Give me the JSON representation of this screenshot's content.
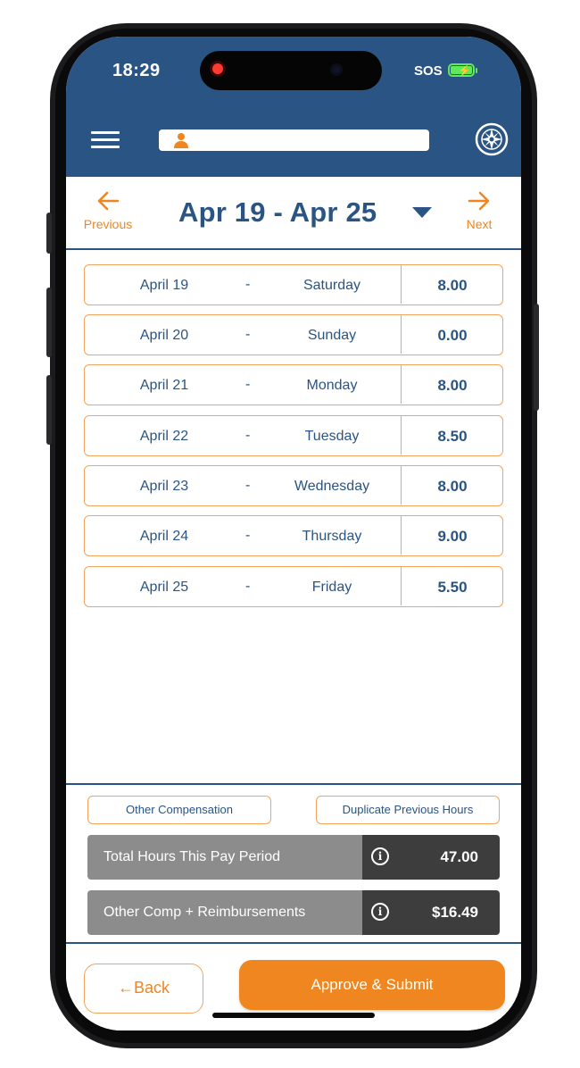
{
  "status_bar": {
    "time": "18:29",
    "carrier": "SOS",
    "battery_icon": "battery-charging-icon"
  },
  "header": {
    "menu_icon": "hamburger-menu-icon",
    "user_icon": "person-icon",
    "user_name": "",
    "settings_icon": "compass-icon",
    "color": "#2a5483"
  },
  "nav": {
    "previous_label": "Previous",
    "next_label": "Next",
    "period": "Apr 19 - Apr 25",
    "dropdown_icon": "caret-down-icon"
  },
  "days": [
    {
      "date": "April 19",
      "separator": "-",
      "weekday": "Saturday",
      "hours": "8.00"
    },
    {
      "date": "April 20",
      "separator": "-",
      "weekday": "Sunday",
      "hours": "0.00"
    },
    {
      "date": "April 21",
      "separator": "-",
      "weekday": "Monday",
      "hours": "8.00"
    },
    {
      "date": "April 22",
      "separator": "-",
      "weekday": "Tuesday",
      "hours": "8.50"
    },
    {
      "date": "April 23",
      "separator": "-",
      "weekday": "Wednesday",
      "hours": "8.00"
    },
    {
      "date": "April 24",
      "separator": "-",
      "weekday": "Thursday",
      "hours": "9.00"
    },
    {
      "date": "April 25",
      "separator": "-",
      "weekday": "Friday",
      "hours": "5.50"
    }
  ],
  "footer": {
    "other_compensation_label": "Other Compensation",
    "duplicate_label": "Duplicate Previous Hours",
    "total_hours_label": "Total Hours This Pay Period",
    "total_hours_value": "47.00",
    "other_comp_label": "Other Comp + Reimbursements",
    "other_comp_value": "$16.49",
    "info_icon": "info-icon"
  },
  "actions": {
    "back_label": "Back",
    "back_arrow": "←",
    "submit_label": "Approve & Submit"
  },
  "colors": {
    "accent": "#f0861f",
    "primary": "#2a5483",
    "summary_label_bg": "#8c8c8c",
    "summary_value_bg": "#3d3d3d"
  }
}
